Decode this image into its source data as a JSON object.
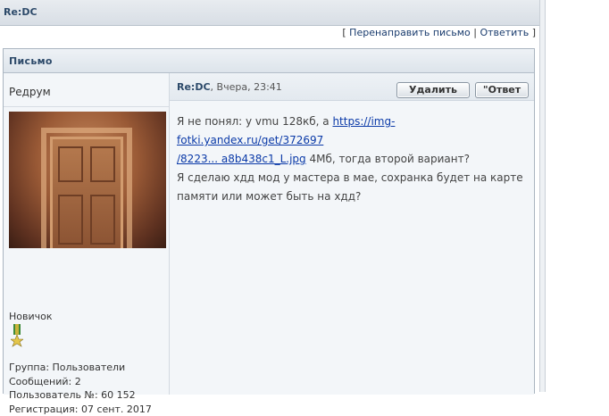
{
  "topic": {
    "title": "Re:DC"
  },
  "actions": {
    "open_bracket": "[ ",
    "forward": "Перенаправить письмо",
    "sep": " | ",
    "reply": "Ответить",
    "close_bracket": " ]"
  },
  "panel": {
    "title": "Письмо"
  },
  "author": {
    "name": "Редрум",
    "rank": "Новичок",
    "group": "Группа: Пользователи",
    "posts": "Сообщений: 2",
    "user_no": "Пользователь №: 60 152",
    "registered": "Регистрация: 07 сент. 2017"
  },
  "post": {
    "title": "Re:DC",
    "meta": ", Вчера, 23:41",
    "delete_label": "Удалить",
    "reply_label": "\"Ответ",
    "text1": "Я не понял: у vmu 128кб, а ",
    "link_part1": "https://img-fotki.yandex.ru/get/372697",
    "link_part2": "/8223... a8b438c1_L.jpg",
    "text2": " 4Мб, тогда второй вариант?",
    "text3": "Я сделаю хдд мод у мастера в мае, сохранка будет на карте памяти или может быть на хдд?"
  },
  "colors": {
    "accent": "#2d4a6a",
    "link": "#0b3aa8",
    "panel_bg": "#f3f6f9"
  }
}
